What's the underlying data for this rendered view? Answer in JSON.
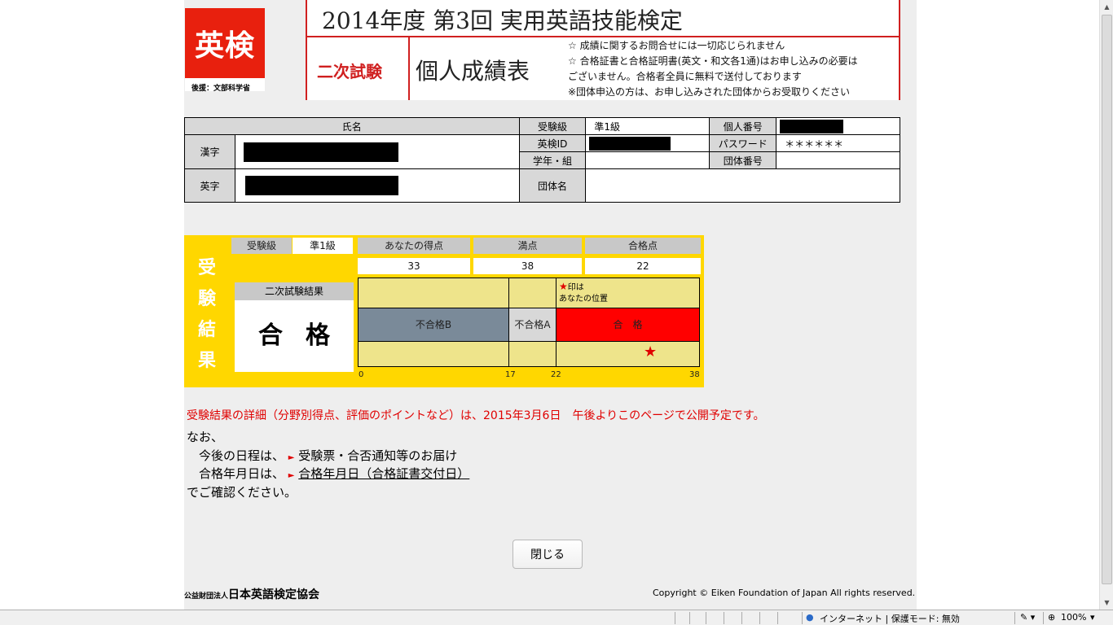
{
  "header": {
    "logo_text": "英検",
    "logo_sub": "後援：文部科学省",
    "title": "2014年度  第3回  実用英語技能検定",
    "exam_type": "二次試験",
    "report_title": "個人成績表",
    "notes": [
      "☆ 成績に関するお問合せには一切応じられません",
      "☆ 合格証書と合格証明書(英文・和文各1通)はお申し込みの必要は",
      "ございません。合格者全員に無料で送付しております",
      "※団体申込の方は、お申し込みされた団体からお受取りください"
    ]
  },
  "info": {
    "name_label": "氏名",
    "kanji_label": "漢字",
    "eiji_label": "英字",
    "grade_label": "受験級",
    "grade_value": "準1級",
    "eikenid_label": "英検ID",
    "class_label": "学年・組",
    "group_label": "団体名",
    "personal_no_label": "個人番号",
    "password_label": "パスワード",
    "password_value": "＊＊＊＊＊＊",
    "group_no_label": "団体番号"
  },
  "result": {
    "side_label": [
      "受",
      "験",
      "結",
      "果"
    ],
    "grade_label": "受験級",
    "grade_value": "準1級",
    "col_score": "あなたの得点",
    "col_full": "満点",
    "col_pass": "合格点",
    "score": "33",
    "full": "38",
    "pass_score": "22",
    "second_result_label": "二次試験結果",
    "second_result_value": "合格",
    "star_note_1": "印は",
    "star_note_2": "あなたの位置",
    "seg_b": "不合格B",
    "seg_a": "不合格A",
    "seg_pass": "合　格",
    "ticks": [
      "0",
      "17",
      "22",
      "38"
    ],
    "colors": {
      "fail_b": "#7a8a99",
      "fail_a": "#d8d8d8",
      "pass": "#ff0000",
      "band": "#eee48b",
      "frame": "#ffd700"
    }
  },
  "messages": {
    "detail": "受験結果の詳細（分野別得点、評価のポイントなど）は、2015年3月6日　午後よりこのページで公開予定です。",
    "nao": "なお、",
    "schedule_prefix": "　今後の日程は、",
    "schedule_link": "受験票・合否通知等のお届け",
    "date_prefix": "　合格年月日は、",
    "date_link": "合格年月日（合格証書交付日）",
    "confirm": "でご確認ください。"
  },
  "close_label": "閉じる",
  "footer": {
    "org_prefix": "公益財団法人",
    "org_name": "日本英語検定協会",
    "copyright": "Copyright © Eiken Foundation of Japan All rights reserved."
  },
  "statusbar": {
    "zone": "インターネット | 保護モード: 無効",
    "zoom": "100%"
  }
}
